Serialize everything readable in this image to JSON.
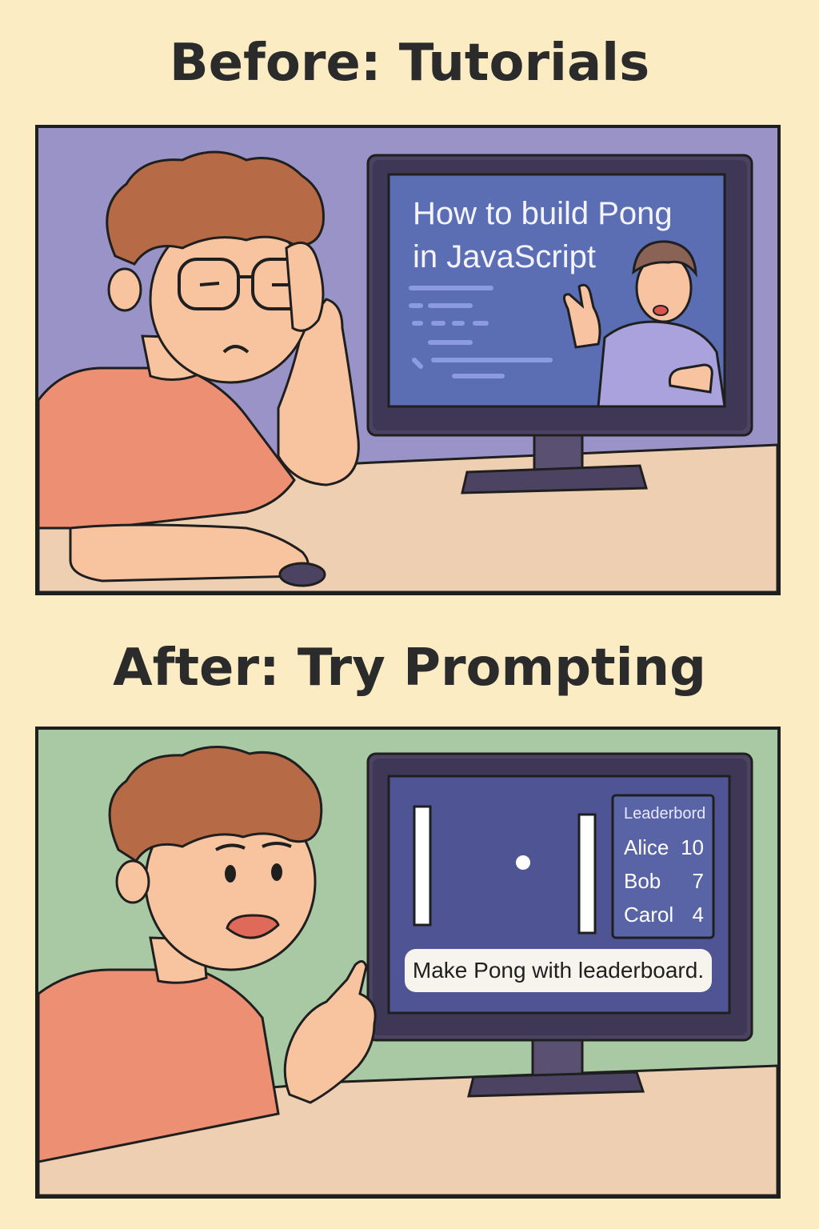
{
  "panels": [
    {
      "heading": "Before: Tutorials",
      "screen": {
        "tutorial_title_line1": "How to build Pong",
        "tutorial_title_line2": "in JavaScript"
      }
    },
    {
      "heading": "After: Try Prompting",
      "screen": {
        "leaderboard_title": "Leaderbord",
        "leaderboard": [
          {
            "name": "Alice",
            "score": "10"
          },
          {
            "name": "Bob",
            "score": "7"
          },
          {
            "name": "Carol",
            "score": "4"
          }
        ],
        "prompt": "Make Pong with leaderboard."
      }
    }
  ],
  "colors": {
    "page_bg": "#fbecc4",
    "panel1_bg": "#9a93c8",
    "panel2_bg": "#a8c9a3",
    "desk": "#efcfb1",
    "shirt": "#ec8f73",
    "skin": "#f8c4a0",
    "hair": "#b66a45",
    "screen_blue": "#5b6eb4",
    "screen_game": "#4f5494",
    "monitor": "#4c4362"
  },
  "icons": [
    "monitor-icon",
    "person-icon",
    "pong-ball-icon",
    "paddle-icon"
  ]
}
